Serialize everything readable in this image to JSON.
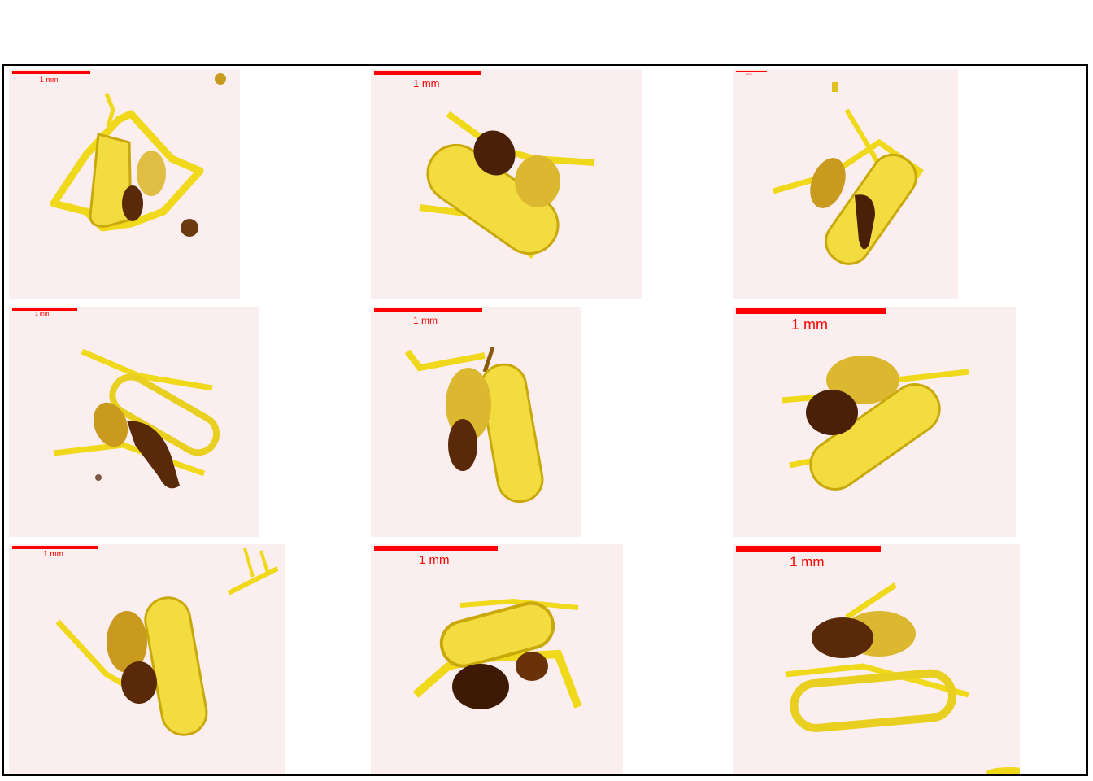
{
  "figure": {
    "panel_count": 9,
    "scale_bar_label": "1 mm",
    "colors": {
      "background": "#fbeeef",
      "lorica": "#f0d81a",
      "lorica_outline": "#c9a80a",
      "soft_body": "#d9b22a",
      "gut": "#4a2006",
      "scale_bar": "#ff0000",
      "frame": "#000000"
    },
    "panels": [
      {
        "label": "1 mm"
      },
      {
        "label": "1 mm"
      },
      {
        "label": "1 mm"
      },
      {
        "label": "1 mm"
      },
      {
        "label": "1 mm"
      },
      {
        "label": "1 mm"
      },
      {
        "label": "1 mm"
      },
      {
        "label": "1 mm"
      },
      {
        "label": "1 mm"
      }
    ]
  }
}
